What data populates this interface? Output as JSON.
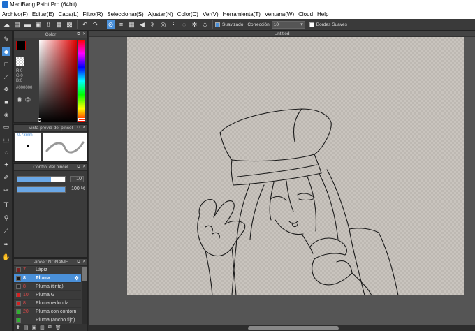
{
  "window": {
    "title": "MediBang Paint Pro (64bit)"
  },
  "menu": [
    "Archivo(F)",
    "Editar(E)",
    "Capa(L)",
    "Filtro(R)",
    "Seleccionar(S)",
    "Ajustar(N)",
    "Color(C)",
    "Ver(V)",
    "Herramienta(T)",
    "Ventana(W)",
    "Cloud",
    "Help"
  ],
  "toolbar": {
    "smoothing_label": "Suavizado",
    "correction_label": "Corrección",
    "correction_value": "10",
    "soft_edges_label": "Bordes Suaves"
  },
  "color_panel": {
    "title": "Color",
    "r": "R:0",
    "g": "G:0",
    "b": "B:0",
    "hex": "#000000",
    "foreground": "#000000",
    "accent_red": "#cc0000"
  },
  "brush_preview": {
    "title": "Vista previa del pincel",
    "size": "0.73mm"
  },
  "brush_control": {
    "title": "Control del pincel",
    "size_value": "10",
    "opacity_value": "100 %",
    "size_fraction": 0.7,
    "opacity_fraction": 1.0
  },
  "brush_list": {
    "title": "Pincel: NONAME",
    "items": [
      {
        "size": "7",
        "name": "Lápiz",
        "color": "#7a1e1e"
      },
      {
        "size": "8",
        "name": "Pluma",
        "color": "#1a1a1a",
        "selected": true
      },
      {
        "size": "8",
        "name": "Pluma (tinta)",
        "color": "#2a2a2a"
      },
      {
        "size": "10",
        "name": "Pluma G",
        "color": "#d42020"
      },
      {
        "size": "8",
        "name": "Pluma redonda",
        "color": "#d42020"
      },
      {
        "size": "20",
        "name": "Pluma con contorn",
        "color": "#30b030"
      },
      {
        "size": "",
        "name": "Pluma (ancho fijo)",
        "color": "#30b030"
      }
    ]
  },
  "document": {
    "tab_title": "Untitled"
  }
}
